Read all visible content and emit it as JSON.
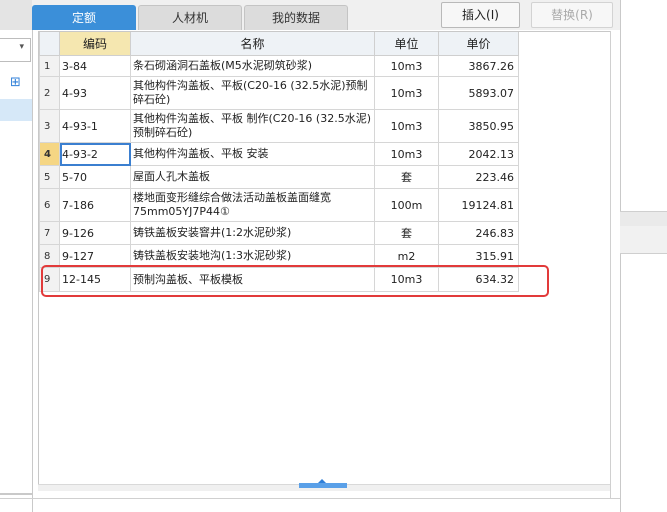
{
  "tabs": [
    {
      "label": "定额",
      "active": true
    },
    {
      "label": "人材机",
      "active": false
    },
    {
      "label": "我的数据",
      "active": false
    }
  ],
  "toolbar": {
    "insert_label": "插入(I)",
    "replace_label": "替换(R)"
  },
  "table": {
    "headers": [
      "编码",
      "名称",
      "单位",
      "单价"
    ],
    "rows": [
      {
        "num": "1",
        "code": "3-84",
        "name": "条石砌涵洞石盖板(M5水泥砌筑砂浆)",
        "unit": "10m3",
        "price": "3867.26"
      },
      {
        "num": "2",
        "code": "4-93",
        "name": "其他构件沟盖板、平板(C20-16 (32.5水泥)预制碎石砼)",
        "unit": "10m3",
        "price": "5893.07"
      },
      {
        "num": "3",
        "code": "4-93-1",
        "name": "其他构件沟盖板、平板 制作(C20-16 (32.5水泥)预制碎石砼)",
        "unit": "10m3",
        "price": "3850.95"
      },
      {
        "num": "4",
        "code": "4-93-2",
        "name": "其他构件沟盖板、平板 安装",
        "unit": "10m3",
        "price": "2042.13"
      },
      {
        "num": "5",
        "code": "5-70",
        "name": "屋面人孔木盖板",
        "unit": "套",
        "price": "223.46"
      },
      {
        "num": "6",
        "code": "7-186",
        "name": "楼地面变形缝综合做法活动盖板盖面缝宽75mm05YJ7P44①",
        "unit": "100m",
        "price": "19124.81"
      },
      {
        "num": "7",
        "code": "9-126",
        "name": "铸铁盖板安装窨井(1:2水泥砂浆)",
        "unit": "套",
        "price": "246.83"
      },
      {
        "num": "8",
        "code": "9-127",
        "name": "铸铁盖板安装地沟(1:3水泥砂浆)",
        "unit": "m2",
        "price": "315.91"
      },
      {
        "num": "9",
        "code": "12-145",
        "name": "预制沟盖板、平板模板",
        "unit": "10m3",
        "price": "634.32"
      }
    ]
  },
  "colors": {
    "active_tab": "#3b8fd9",
    "highlight_border": "#e23a3a",
    "selected_row_number": "#f5d684"
  }
}
